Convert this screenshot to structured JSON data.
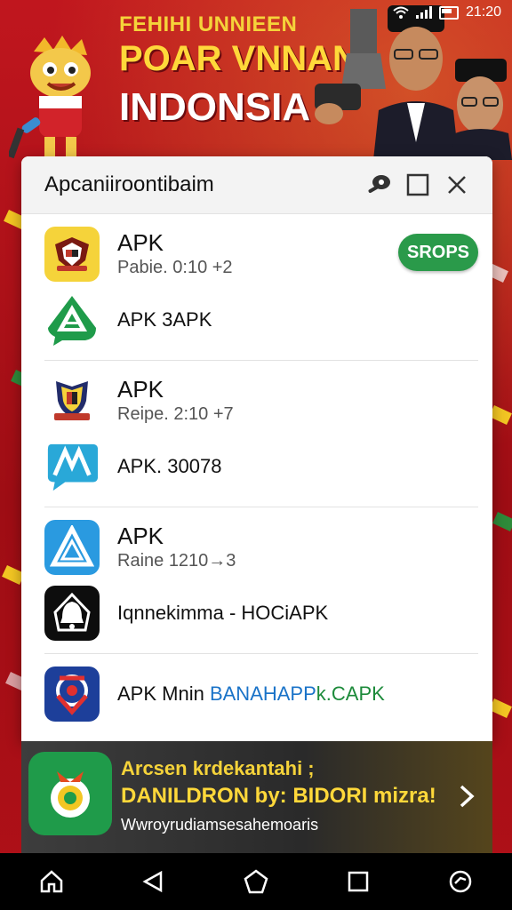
{
  "status_bar": {
    "time": "21:20"
  },
  "banner": {
    "line1": "FEHIHI UNNIEEN",
    "line2": "POAR VNNANI",
    "line3": "INDONSIA"
  },
  "dialog": {
    "title": "Apcaniiroontibaim",
    "items": [
      {
        "name": "APK",
        "sub": "Pabie. 0:10 +2",
        "second": "APK 3APK",
        "action": "SROPS"
      },
      {
        "name": "APK",
        "sub": "Reipe. 2:10 +7",
        "second": "APK. 30078"
      },
      {
        "name": "APK",
        "sub": "Raine 1210→3",
        "second": "Iqnnekimma - HOCiAPK"
      }
    ],
    "last": {
      "a": "APK Mnin",
      "b": "BANAHAPP",
      "c": "k.CAPK"
    }
  },
  "ad": {
    "line1": "Arcsen krdekantahi ;",
    "line2": "DANILDRON by: BIDORI mizra!",
    "line3": "Wwroyrudiamsesahemoaris"
  },
  "colors": {
    "accent_green": "#2a9a4a",
    "banner_red": "#b3121a",
    "title_yellow": "#ffd83a"
  }
}
